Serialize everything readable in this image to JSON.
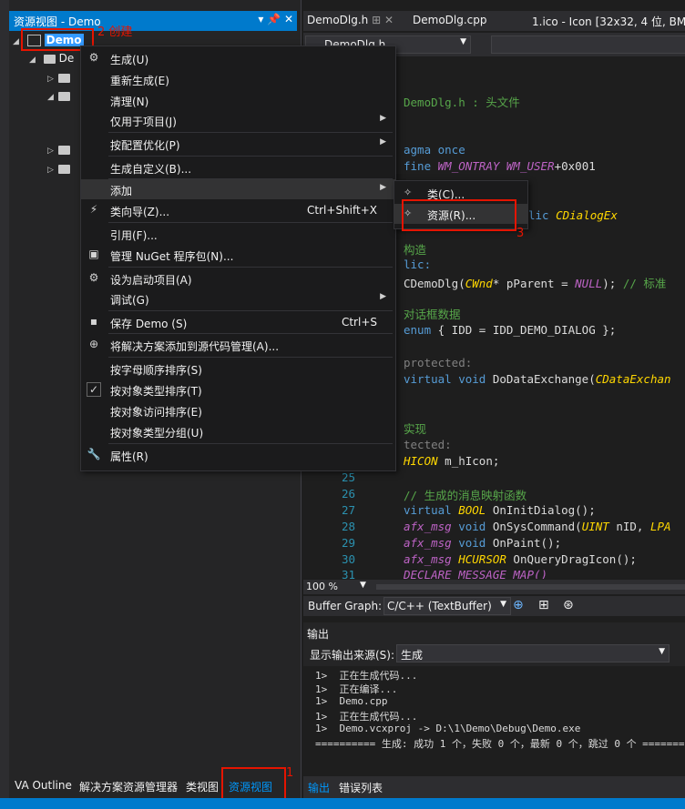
{
  "resource_view": {
    "title": "资源视图 - Demo",
    "title_buttons": "▾ ✕",
    "root_label": "Demo",
    "child_label": "De"
  },
  "annotations": {
    "create": "2 创建",
    "add_resource": "3",
    "tab_num": "1"
  },
  "context_menu": {
    "items": [
      {
        "label": "生成(U)"
      },
      {
        "label": "重新生成(E)"
      },
      {
        "label": "清理(N)"
      },
      {
        "label": "仅用于项目(J)"
      },
      {
        "label": "按配置优化(P)"
      },
      {
        "label": "生成自定义(B)..."
      },
      {
        "label": "添加"
      },
      {
        "label": "类向导(Z)...",
        "shortcut": "Ctrl+Shift+X"
      },
      {
        "label": "引用(F)..."
      },
      {
        "label": "管理 NuGet 程序包(N)..."
      },
      {
        "label": "设为启动项目(A)"
      },
      {
        "label": "调试(G)"
      },
      {
        "label": "保存 Demo (S)",
        "shortcut": "Ctrl+S"
      },
      {
        "label": "将解决方案添加到源代码管理(A)..."
      },
      {
        "label": "按字母顺序排序(S)"
      },
      {
        "label": "按对象类型排序(T)"
      },
      {
        "label": "按对象访问排序(E)"
      },
      {
        "label": "按对象类型分组(U)"
      },
      {
        "label": "属性(R)"
      }
    ]
  },
  "submenu": {
    "items": [
      {
        "label": "类(C)..."
      },
      {
        "label": "资源(R)..."
      }
    ]
  },
  "bottom_tabs": [
    "VA Outline",
    "解决方案资源管理器",
    "类视图",
    "资源视图"
  ],
  "editor": {
    "tabs": [
      "DemoDlg.h",
      "DemoDlg.cpp",
      "1.ico - Icon [32x32, 4 位, BMP]"
    ],
    "nav_file": "DemoDlg.h",
    "code": {
      "l1_comment": "DemoDlg.h : 头文件",
      "l2": "agma once",
      "l3_pre": "fine ",
      "l3_mac1": "WM_ONTRAY",
      "l3_mac2": "WM_USER",
      "l3_post": "+0x001",
      "l4_kw": "lic ",
      "l4_ty": "CDialogEx",
      "l5_comment": "构造",
      "l6": "lic:",
      "l7_a": "CDemoDlg(",
      "l7_ty": "CWnd",
      "l7_b": "* pParent = ",
      "l7_mac": "NULL",
      "l7_c": "); ",
      "l7_cm": "// 标准",
      "l8_comment": "对话框数据",
      "l9_kw": "enum",
      "l9_rest": " { IDD = IDD_DEMO_DIALOG };",
      "l10": "protected:",
      "l11_kw": "virtual void ",
      "l11_a": "DoDataExchange(",
      "l11_ty": "CDataExchan",
      "l12_comment": "实现",
      "l13": "tected:",
      "l14_ty": "HICON",
      "l14_rest": " m_hIcon;",
      "l15_comment": "// 生成的消息映射函数",
      "l16_kw": "virtual ",
      "l16_ty": "BOOL",
      "l16_rest": " OnInitDialog();",
      "l17_mac": "afx_msg",
      "l17_kw": " void ",
      "l17_a": "OnSysCommand(",
      "l17_ty": "UINT",
      "l17_b": " nID, ",
      "l17_ty2": "LPA",
      "l18_mac": "afx_msg",
      "l18_kw": " void ",
      "l18_a": "OnPaint();",
      "l19_mac": "afx_msg",
      "l19_ty": " HCURSOR",
      "l19_a": " OnQueryDragIcon();",
      "l20_mac": "DECLARE_MESSAGE_MAP()"
    },
    "line_numbers": [
      "25",
      "26",
      "27",
      "28",
      "29",
      "30",
      "31"
    ],
    "zoom": "100 %"
  },
  "buffer_graph": {
    "label": "Buffer Graph:",
    "value": "C/C++ (TextBuffer)"
  },
  "output": {
    "title": "输出",
    "source_label": "显示输出来源(S):",
    "source_value": "生成",
    "lines": [
      "1>  正在生成代码...",
      "1>  正在编译...",
      "1>  Demo.cpp",
      "1>  正在生成代码...",
      "1>  Demo.vcxproj -> D:\\1\\Demo\\Debug\\Demo.exe",
      "========== 生成: 成功 1 个，失败 0 个，最新 0 个，跳过 0 个 =========="
    ],
    "tabs": [
      "输出",
      "错误列表"
    ]
  }
}
